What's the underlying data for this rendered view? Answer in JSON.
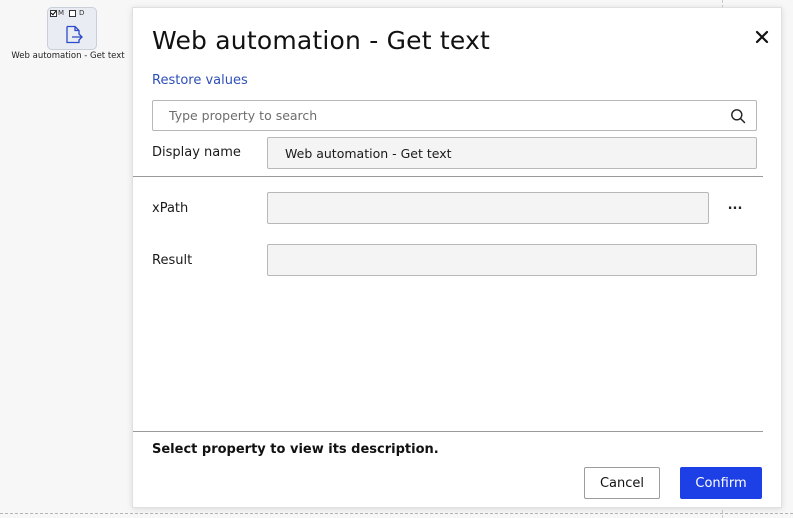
{
  "canvas": {
    "node": {
      "flag_m": "M",
      "flag_d": "D",
      "label": "Web automation - Get text",
      "icon": "document-export-icon"
    }
  },
  "dialog": {
    "title": "Web automation - Get text",
    "close_icon": "close-icon",
    "restore_label": "Restore values",
    "search": {
      "placeholder": "Type property to search",
      "value": "",
      "icon": "search-icon"
    },
    "properties": {
      "display_name": {
        "label": "Display name",
        "value": "Web automation - Get text"
      },
      "xpath": {
        "label": "xPath",
        "value": "",
        "more_label": "..."
      },
      "result": {
        "label": "Result",
        "value": ""
      }
    },
    "description": "Select property to view its description.",
    "cancel_label": "Cancel",
    "confirm_label": "Confirm"
  },
  "colors": {
    "accent": "#1d3fe6",
    "link": "#2e4fb6"
  }
}
